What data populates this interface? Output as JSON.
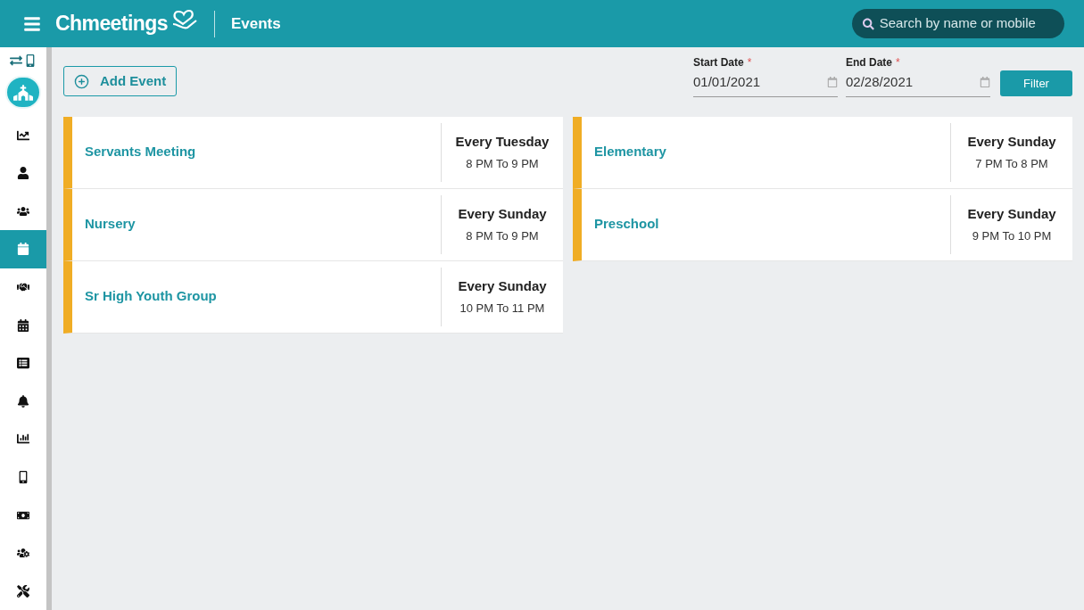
{
  "header": {
    "brand": "Chmeetings",
    "title": "Events",
    "search": {
      "placeholder": "Search by name or mobile"
    }
  },
  "sidebar": {
    "items": [
      {
        "selected": false
      },
      {
        "selected": false
      },
      {
        "selected": false
      },
      {
        "selected": true
      },
      {
        "selected": false
      },
      {
        "selected": false
      },
      {
        "selected": false
      },
      {
        "selected": false
      },
      {
        "selected": false
      },
      {
        "selected": false
      },
      {
        "selected": false
      },
      {
        "selected": false
      },
      {
        "selected": false
      }
    ]
  },
  "toolbar": {
    "add_button": "Add Event",
    "start_date": {
      "label": "Start Date",
      "required_mark": "*",
      "value": "01/01/2021"
    },
    "end_date": {
      "label": "End Date",
      "required_mark": "*",
      "value": "02/28/2021"
    },
    "filter_button": "Filter"
  },
  "event_columns": [
    [
      {
        "name": "Servants Meeting",
        "recurrence": "Every Tuesday",
        "time": "8 PM To 9 PM"
      },
      {
        "name": "Nursery",
        "recurrence": "Every Sunday",
        "time": "8 PM To 9 PM"
      },
      {
        "name": "Sr High Youth Group",
        "recurrence": "Every Sunday",
        "time": "10 PM To 11 PM"
      }
    ],
    [
      {
        "name": "Elementary",
        "recurrence": "Every Sunday",
        "time": "7 PM To 8 PM"
      },
      {
        "name": "Preschool",
        "recurrence": "Every Sunday",
        "time": "9 PM To 10 PM"
      }
    ]
  ]
}
